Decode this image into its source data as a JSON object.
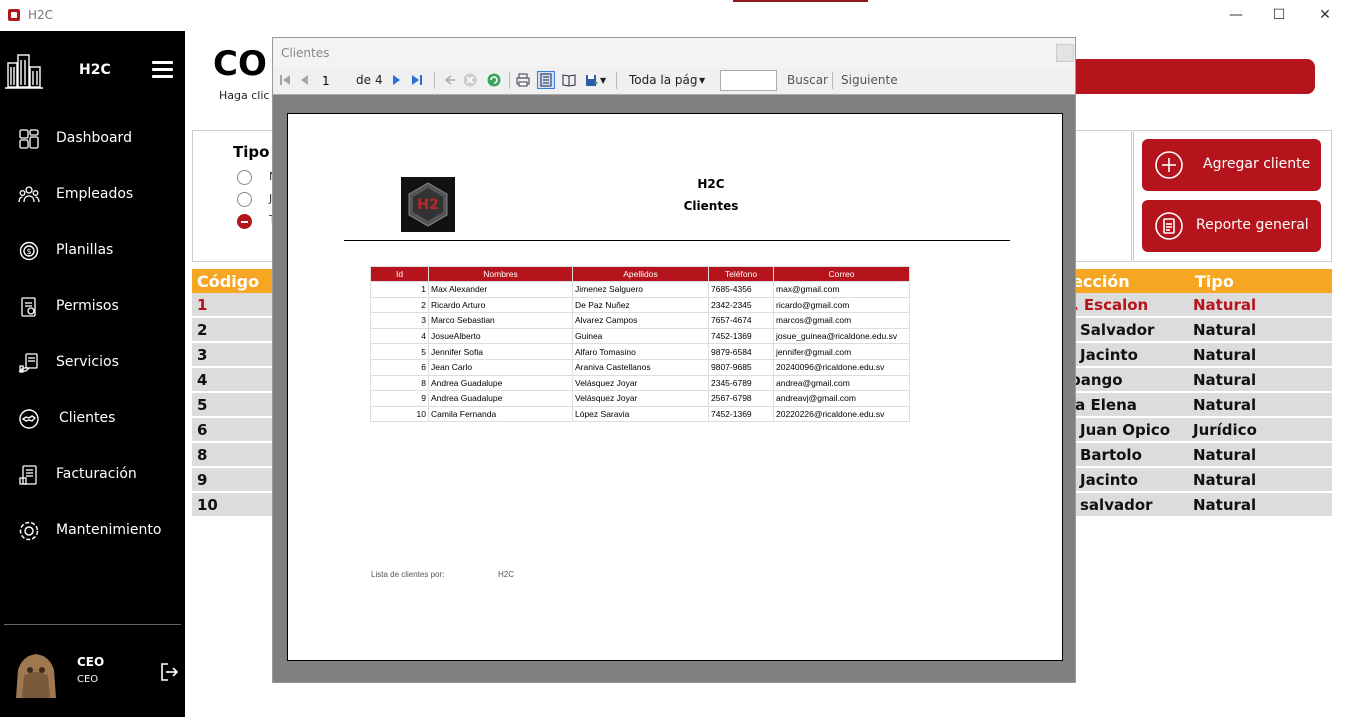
{
  "window": {
    "title": "H2C",
    "minimize": "—",
    "maximize": "☐",
    "close": "✕"
  },
  "sidebar": {
    "brand": "H2C",
    "items": [
      {
        "label": "Dashboard",
        "icon": "dashboard-icon"
      },
      {
        "label": "Empleados",
        "icon": "employees-icon"
      },
      {
        "label": "Planillas",
        "icon": "payroll-icon"
      },
      {
        "label": "Permisos",
        "icon": "permissions-icon"
      },
      {
        "label": "Servicios",
        "icon": "services-icon"
      },
      {
        "label": "Clientes",
        "icon": "clients-icon"
      },
      {
        "label": "Facturación",
        "icon": "billing-icon"
      },
      {
        "label": "Mantenimiento",
        "icon": "maintenance-icon"
      }
    ],
    "user": {
      "name": "CEO",
      "role": "CEO"
    }
  },
  "main": {
    "title": "CO",
    "subtitle": "Haga clic",
    "filter_title": "Tipo c",
    "radios": [
      {
        "label": "N",
        "checked": false
      },
      {
        "label": "J",
        "checked": false
      },
      {
        "label": "T",
        "checked": true
      }
    ],
    "actions": {
      "add": "Agregar cliente",
      "report": "Reporte general"
    },
    "table": {
      "headers": {
        "code": "Código",
        "address": "ección",
        "type": "Tipo"
      },
      "rows": [
        {
          "code": "1",
          "address": ". Escalon",
          "type": "Natural"
        },
        {
          "code": "2",
          "address": "Salvador",
          "type": "Natural"
        },
        {
          "code": "3",
          "address": "Jacinto",
          "type": "Natural"
        },
        {
          "code": "4",
          "address": "pango",
          "type": "Natural"
        },
        {
          "code": "5",
          "address": "ta Elena",
          "type": "Natural"
        },
        {
          "code": "6",
          "address": "Juan Opico",
          "type": "Jurídico"
        },
        {
          "code": "8",
          "address": "Bartolo",
          "type": "Natural"
        },
        {
          "code": "9",
          "address": "Jacinto",
          "type": "Natural"
        },
        {
          "code": "10",
          "address": "salvador",
          "type": "Natural"
        }
      ]
    }
  },
  "dialog": {
    "title": "Clientes",
    "toolbar": {
      "page": "1",
      "of_label": "de",
      "total_pages": "4",
      "zoom": "Toda la pág",
      "find_label": "Buscar",
      "next_label": "Siguiente"
    },
    "report": {
      "company": "H2C",
      "title": "Clientes",
      "columns": [
        "Id",
        "Nombres",
        "Apellidos",
        "Teléfono",
        "Correo"
      ],
      "rows": [
        [
          "1",
          "Max Alexander",
          "Jimenez Salguero",
          "7685-4356",
          "max@gmail.com"
        ],
        [
          "2",
          "Ricardo Arturo",
          "De Paz Nuñez",
          "2342-2345",
          "ricardo@gmail.com"
        ],
        [
          "3",
          "Marco Sebastian",
          "Alvarez Campos",
          "7657-4674",
          "marcos@gmail.com"
        ],
        [
          "4",
          "JosueAlberto",
          "Guinea",
          "7452-1369",
          "josue_guinea@ricaldone.edu.sv"
        ],
        [
          "5",
          "Jennifer Sofia",
          "Alfaro Tomasino",
          "9879-6584",
          "jennifer@gmail.com"
        ],
        [
          "6",
          "Jean Carlo",
          "Araniva Castellanos",
          "9807-9685",
          "20240096@ricaldone.edu.sv"
        ],
        [
          "8",
          "Andrea Guadalupe",
          "Velásquez Joyar",
          "2345-6789",
          "andrea@gmail.com"
        ],
        [
          "9",
          "Andrea Guadalupe",
          "Velásquez Joyar",
          "2567-6798",
          "andreavj@gmail.com"
        ],
        [
          "10",
          "Camila Fernanda",
          "López Saravia",
          "7452-1369",
          "20220226@ricaldone.edu.sv"
        ]
      ],
      "footer_label": "Lista de clientes por:",
      "footer_value": "H2C"
    }
  }
}
